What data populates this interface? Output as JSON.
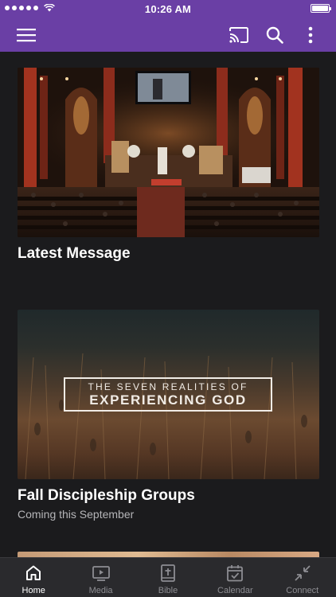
{
  "status_bar": {
    "time": "10:26 AM"
  },
  "nav": {
    "menu_icon": "hamburger-menu-icon",
    "cast_icon": "cast-icon",
    "search_icon": "search-icon",
    "more_icon": "more-vertical-icon",
    "bar_color": "#6a3fa5"
  },
  "cards": [
    {
      "title": "Latest Message",
      "subtitle": ""
    },
    {
      "title": "Fall Discipleship Groups",
      "subtitle": "Coming this September",
      "image_text_line1": "THE SEVEN REALITIES OF",
      "image_text_line2": "EXPERIENCING GOD"
    }
  ],
  "tabs": [
    {
      "label": "Home",
      "icon": "home-icon",
      "active": true
    },
    {
      "label": "Media",
      "icon": "media-icon",
      "active": false
    },
    {
      "label": "Bible",
      "icon": "bible-icon",
      "active": false
    },
    {
      "label": "Calendar",
      "icon": "calendar-icon",
      "active": false
    },
    {
      "label": "Connect",
      "icon": "connect-icon",
      "active": false
    }
  ]
}
